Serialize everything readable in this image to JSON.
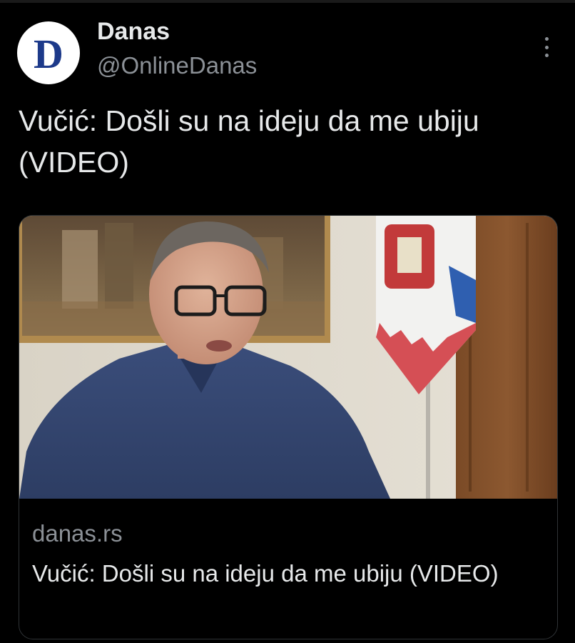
{
  "account": {
    "display_name": "Danas",
    "handle": "@OnlineDanas",
    "avatar_letter": "D",
    "avatar_color": "#1d3a8a"
  },
  "menu": {
    "icon": "more-vertical-icon"
  },
  "tweet": {
    "text": "Vučić: Došli su na ideju da me ubiju (VIDEO)"
  },
  "link_card": {
    "domain": "danas.rs",
    "title": "Vučić: Došli su na ideju da me ubiju (VIDEO)"
  },
  "colors": {
    "background": "#000000",
    "primary_text": "#e7e9ea",
    "secondary_text": "#8b9096",
    "card_border": "#2f3336"
  }
}
